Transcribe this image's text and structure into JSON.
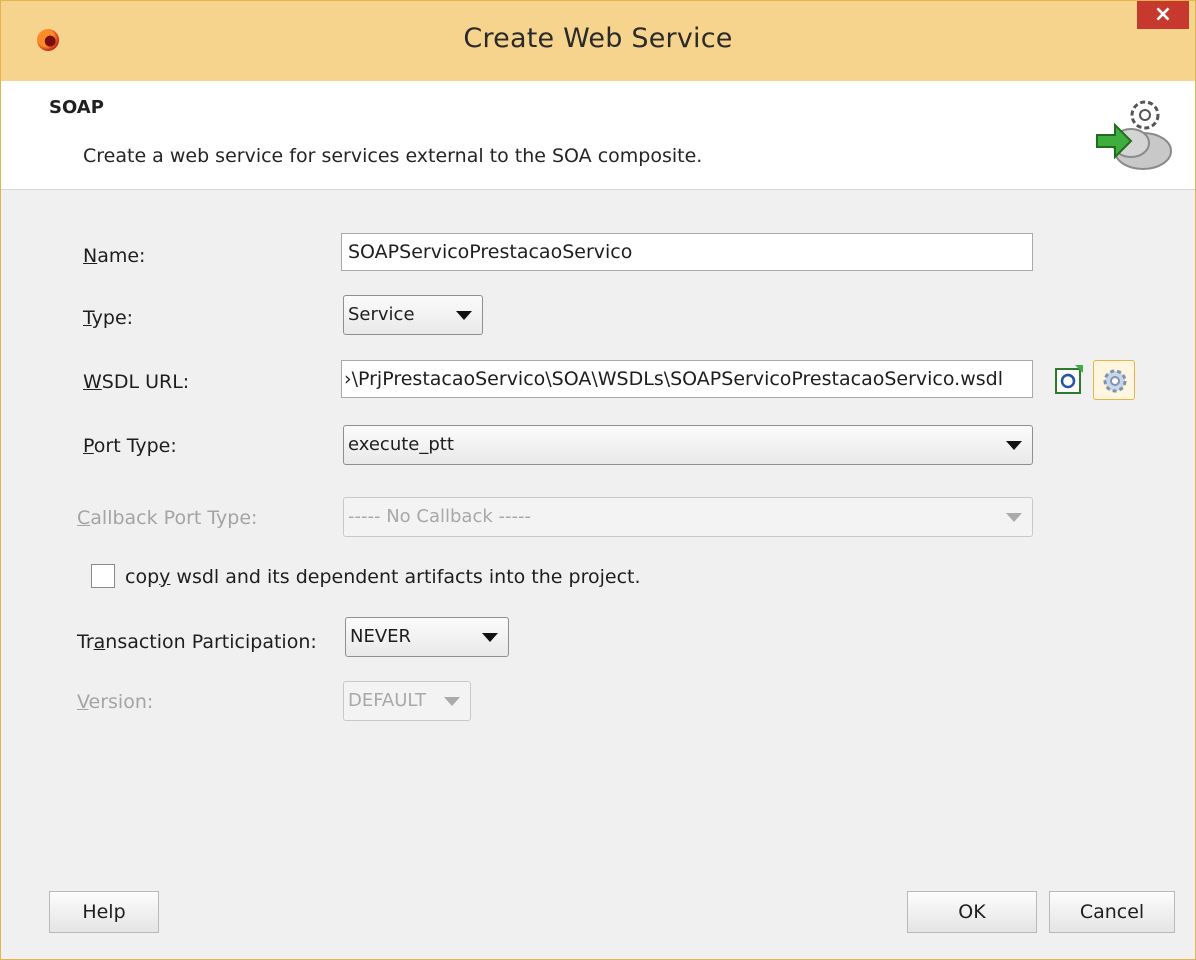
{
  "window": {
    "title": "Create Web Service",
    "close_label": "×"
  },
  "header": {
    "title": "SOAP",
    "description": "Create a web service for services external to the SOA composite."
  },
  "form": {
    "name": {
      "label_mn": "N",
      "label_rest": "ame:",
      "value": "SOAPServicoPrestacaoServico"
    },
    "type": {
      "label_mn": "T",
      "label_rest": "ype:",
      "value": "Service"
    },
    "wsdl_url": {
      "label_mn": "W",
      "label_rest": "SDL URL:",
      "value": "›\\PrjPrestacaoServico\\SOA\\WSDLs\\SOAPServicoPrestacaoServico.wsdl"
    },
    "port_type": {
      "label_mn": "P",
      "label_rest": "ort Type:",
      "value": "execute_ptt"
    },
    "callback_port_type": {
      "label_mn": "C",
      "label_rest": "allback Port Type:",
      "value": "----- No Callback -----"
    },
    "copy_wsdl": {
      "label_pre": "cop",
      "label_mn": "y",
      "label_rest": " wsdl and its dependent artifacts into the project.",
      "checked": false
    },
    "transaction_participation": {
      "label_pre": "Tr",
      "label_mn": "a",
      "label_rest": "nsaction Participation:",
      "value": "NEVER"
    },
    "version": {
      "label_mn": "V",
      "label_rest": "ersion:",
      "value": "DEFAULT"
    }
  },
  "icons": {
    "app": "oracle-logo-icon",
    "header": "gear-cloud-arrow-icon",
    "wsdl_browse": "find-wsdl-icon",
    "wsdl_service": "service-explorer-icon"
  },
  "buttons": {
    "help": "Help",
    "ok": "OK",
    "cancel": "Cancel"
  }
}
